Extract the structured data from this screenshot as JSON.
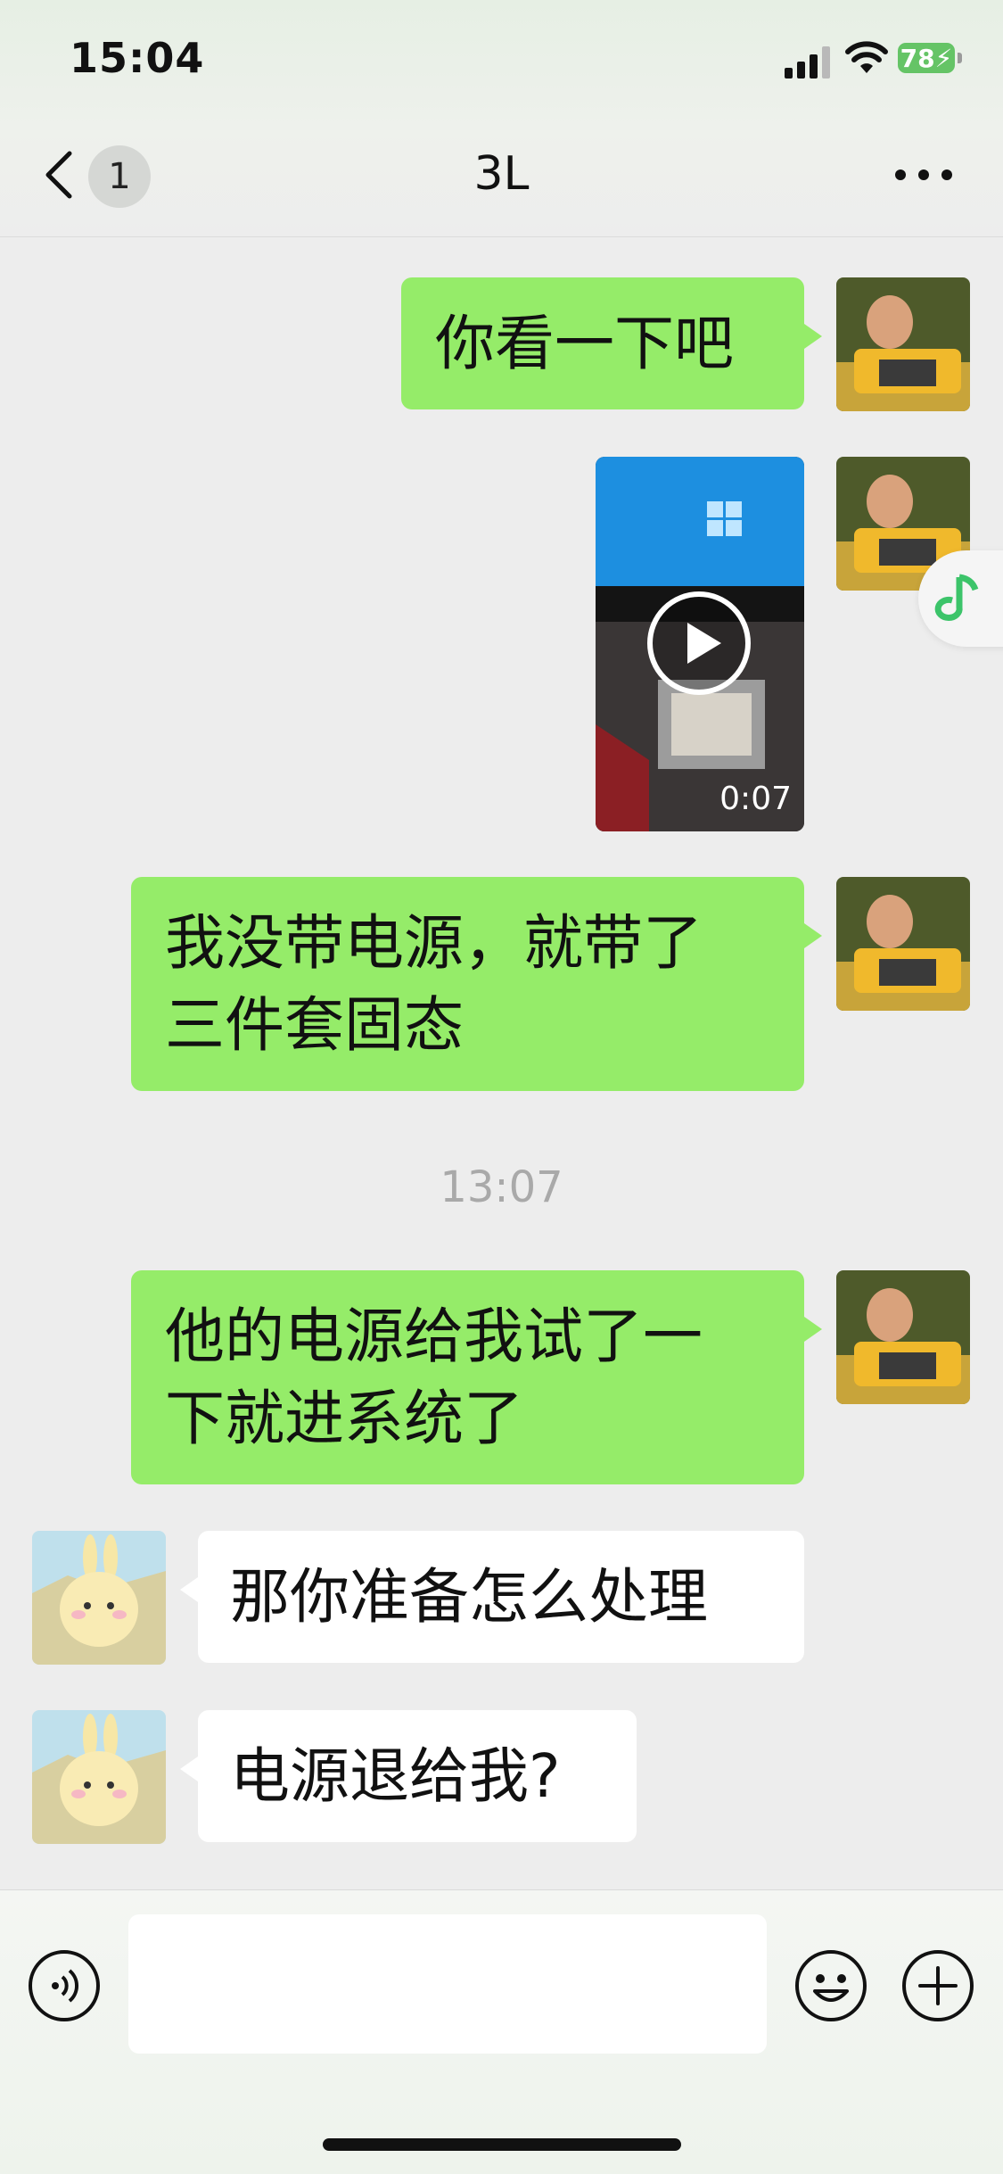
{
  "status_bar": {
    "time": "15:04",
    "battery": "78"
  },
  "header": {
    "back_badge": "1",
    "title": "3L"
  },
  "messages": [
    {
      "side": "out",
      "text": "你看一下吧"
    },
    {
      "side": "out",
      "type": "video",
      "duration": "0:07"
    },
    {
      "side": "out",
      "line1": "我没带电源，就带了",
      "line2": "三件套固态"
    },
    {
      "timestamp": "13:07"
    },
    {
      "side": "out",
      "line1": "他的电源给我试了一",
      "line2": "下就进系统了"
    },
    {
      "side": "in",
      "text": "那你准备怎么处理"
    },
    {
      "side": "in",
      "text": "电源退给我?"
    }
  ],
  "input_bar": {
    "value": "",
    "icons": [
      "voice-icon",
      "emoji-icon",
      "plus-icon"
    ]
  },
  "colors": {
    "outgoing_bubble": "#95ec69",
    "incoming_bubble": "#ffffff",
    "background": "#ededed"
  }
}
